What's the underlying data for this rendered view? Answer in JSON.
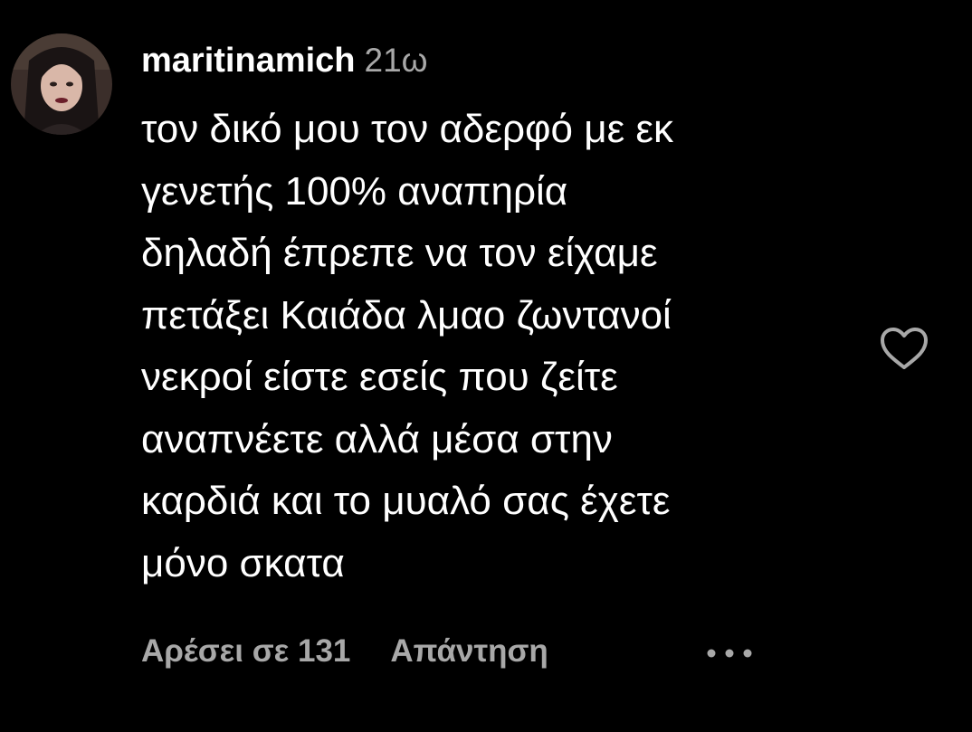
{
  "comment": {
    "username": "maritinamich",
    "timestamp": "21ω",
    "text": "τον δικό μου τον αδερφό με εκ\nγενετής 100% αναπηρία\nδηλαδή έπρεπε να τον είχαμε\nπετάξει Καιάδα λμαο ζωντανοί\nνεκροί είστε εσείς που ζείτε\nαναπνέετε αλλά μέσα στην\nκαρδιά και το μυαλό σας έχετε\nμόνο σκατα",
    "likes_label": "Αρέσει σε 131",
    "reply_label": "Απάντηση",
    "like_icon": "heart-outline-icon",
    "more_icon": "more-options-icon"
  },
  "colors": {
    "background": "#000000",
    "primary_text": "#ffffff",
    "secondary_text": "#a8a8a8"
  }
}
